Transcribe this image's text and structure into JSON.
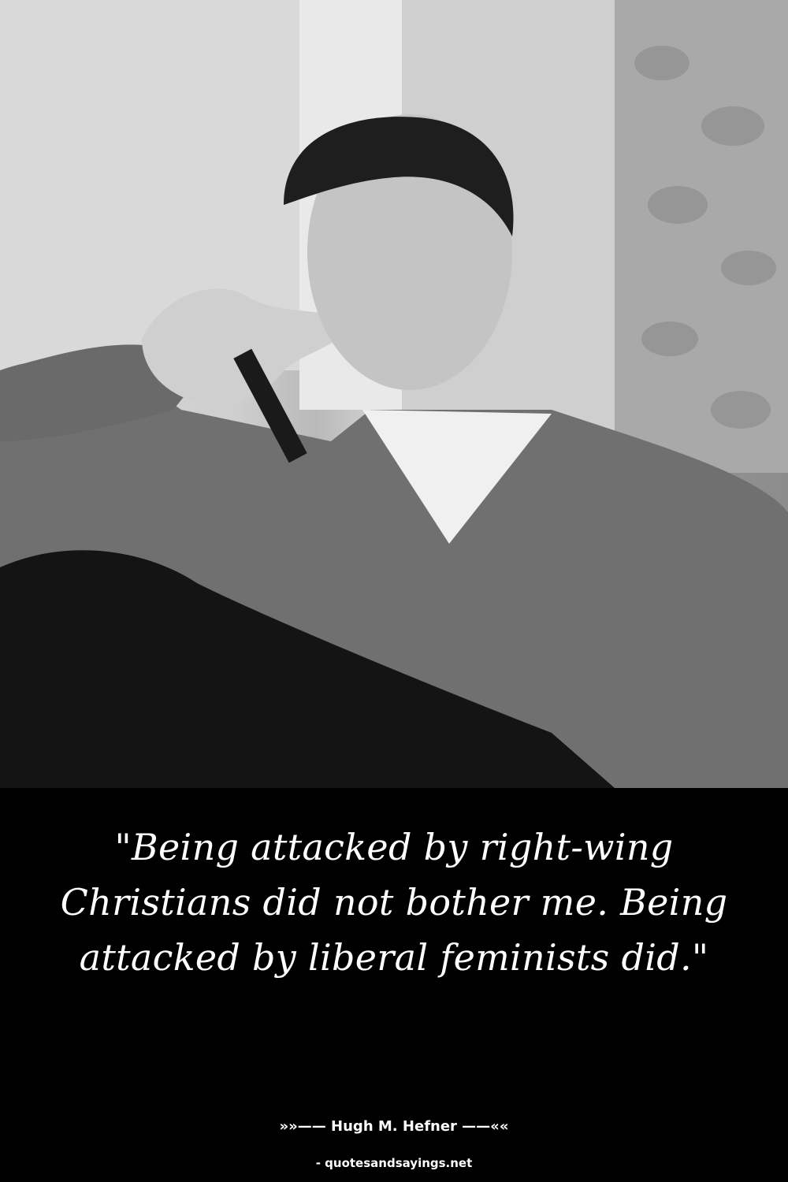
{
  "quote": {
    "text": "\"Being attacked by right-wing Christians did not bother me. Being attacked by liberal feminists did.\""
  },
  "attribution": {
    "author_line": "»»—— Hugh M. Hefner ——««",
    "source": "- quotesandsayings.net"
  },
  "colors": {
    "background": "#000000",
    "text": "#ffffff"
  }
}
